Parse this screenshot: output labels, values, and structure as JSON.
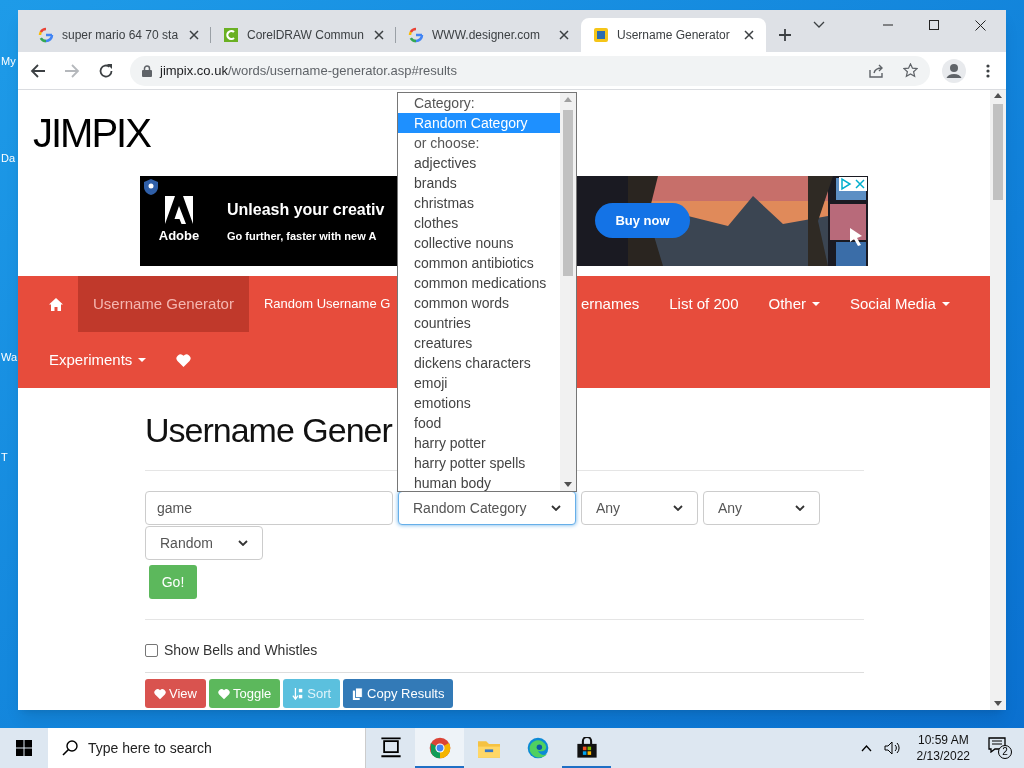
{
  "desktop": {
    "icons": [
      {
        "label": "My"
      },
      {
        "label": "Da"
      },
      {
        "label": "Wa"
      },
      {
        "label": "T"
      }
    ]
  },
  "browser": {
    "tabs": [
      {
        "kind": "google",
        "title": "super mario 64 70 sta",
        "selected": false
      },
      {
        "kind": "corel",
        "title": "CorelDRAW Commun",
        "selected": false
      },
      {
        "kind": "google",
        "title": "WWW.designer.com",
        "selected": false
      },
      {
        "kind": "jimpix",
        "title": "Username Generator",
        "selected": true
      }
    ],
    "address_bar": {
      "host": "jimpix.co.uk",
      "path": "/words/username-generator.asp#results"
    }
  },
  "page": {
    "logo": "JIMPIX",
    "ad": {
      "brand": "Adobe",
      "headline": "Unleash your creativ",
      "subline": "Go further, faster with new A",
      "button": "Buy now"
    },
    "nav": {
      "rows": [
        [
          {
            "kind": "home",
            "selected": false
          },
          {
            "kind": "link",
            "label": "Username Generator",
            "selected": true
          },
          {
            "kind": "link",
            "label": "Random Username G",
            "selected": false
          },
          {
            "kind": "link",
            "label": "ernames",
            "selected": false
          },
          {
            "kind": "link",
            "label": "List of 200",
            "selected": false
          },
          {
            "kind": "menu",
            "label": "Other",
            "selected": false
          },
          {
            "kind": "menu",
            "label": "Social Media",
            "selected": false
          }
        ],
        [
          {
            "kind": "menu",
            "label": "Experiments",
            "selected": false
          },
          {
            "kind": "heart",
            "selected": false
          }
        ]
      ]
    },
    "heading": "Username Gener",
    "form": {
      "word": "game",
      "selects": [
        {
          "value": "Random Category",
          "focused": true
        },
        {
          "value": "Any",
          "focused": false
        },
        {
          "value": "Any",
          "focused": false
        },
        {
          "value": "Random",
          "focused": false
        }
      ],
      "go": "Go!"
    },
    "option": {
      "label": "Show Bells and Whistles",
      "checked": false
    },
    "actions": [
      {
        "kind": "heart",
        "label": "View",
        "color": "#d9534f",
        "disabled": false
      },
      {
        "kind": "heart",
        "label": "Toggle",
        "color": "#5cb85c",
        "disabled": false
      },
      {
        "kind": "sort",
        "label": "Sort",
        "color": "#5bc0de",
        "disabled": true
      },
      {
        "kind": "copy",
        "label": "Copy Results",
        "color": "#337ab7",
        "disabled": false
      }
    ],
    "dropdown": [
      {
        "kind": "group",
        "label": "Category:"
      },
      {
        "kind": "option",
        "label": "Random Category",
        "selected": true
      },
      {
        "kind": "group",
        "label": "or choose:"
      },
      {
        "kind": "option",
        "label": "adjectives",
        "selected": false
      },
      {
        "kind": "option",
        "label": "brands",
        "selected": false
      },
      {
        "kind": "option",
        "label": "christmas",
        "selected": false
      },
      {
        "kind": "option",
        "label": "clothes",
        "selected": false
      },
      {
        "kind": "option",
        "label": "collective nouns",
        "selected": false
      },
      {
        "kind": "option",
        "label": "common antibiotics",
        "selected": false
      },
      {
        "kind": "option",
        "label": "common medications",
        "selected": false
      },
      {
        "kind": "option",
        "label": "common words",
        "selected": false
      },
      {
        "kind": "option",
        "label": "countries",
        "selected": false
      },
      {
        "kind": "option",
        "label": "creatures",
        "selected": false
      },
      {
        "kind": "option",
        "label": "dickens characters",
        "selected": false
      },
      {
        "kind": "option",
        "label": "emoji",
        "selected": false
      },
      {
        "kind": "option",
        "label": "emotions",
        "selected": false
      },
      {
        "kind": "option",
        "label": "food",
        "selected": false
      },
      {
        "kind": "option",
        "label": "harry potter",
        "selected": false
      },
      {
        "kind": "option",
        "label": "harry potter spells",
        "selected": false
      },
      {
        "kind": "option",
        "label": "human body",
        "selected": false
      }
    ]
  },
  "taskbar": {
    "search_placeholder": "Type here to search",
    "apps": [
      {
        "kind": "taskview",
        "active": false
      },
      {
        "kind": "chrome",
        "active": true
      },
      {
        "kind": "folder",
        "active": false
      },
      {
        "kind": "edge",
        "active": false
      },
      {
        "kind": "store",
        "active": true
      }
    ],
    "time": "10:59 AM",
    "date": "2/13/2022",
    "notifications": "2"
  }
}
